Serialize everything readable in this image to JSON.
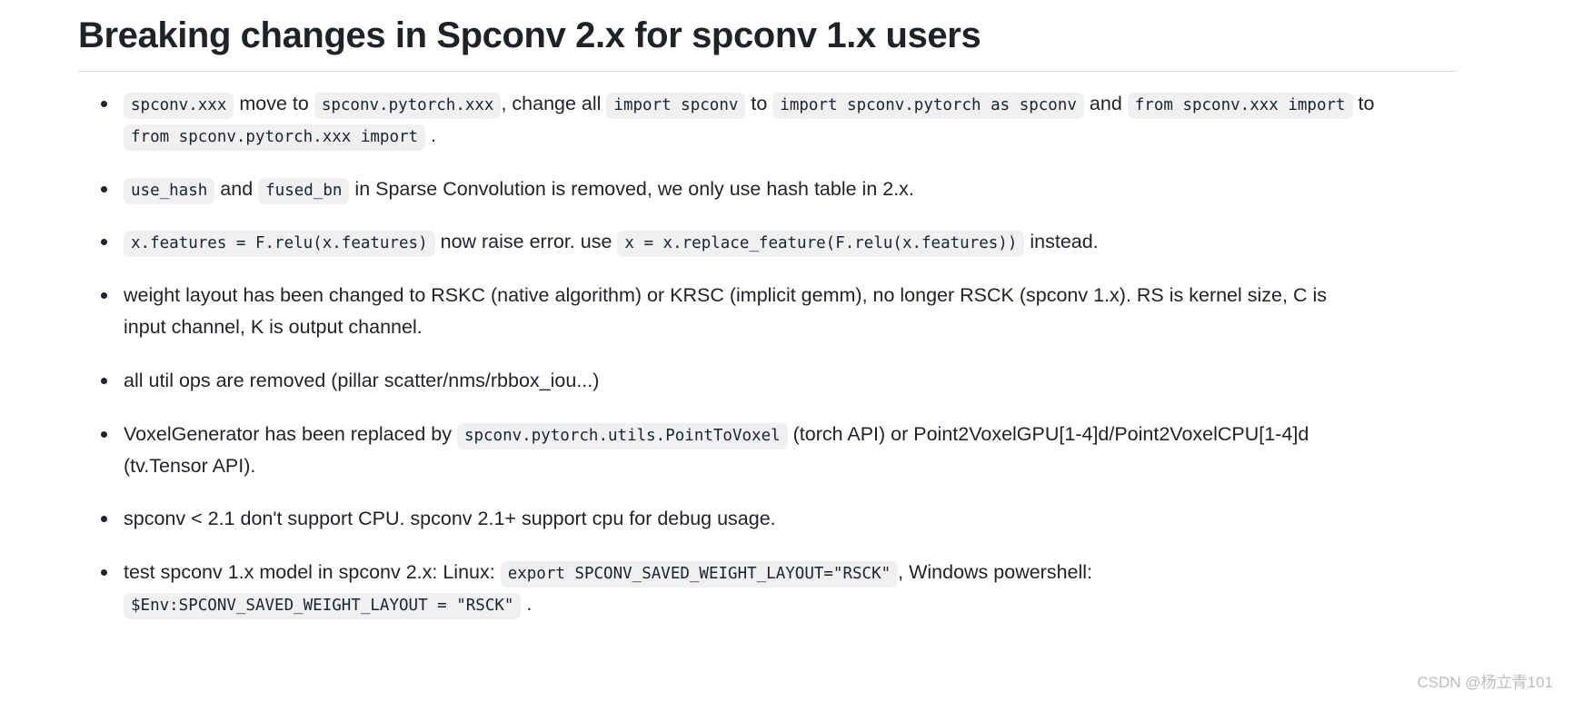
{
  "document": {
    "title": "Breaking changes in Spconv 2.x for spconv 1.x users",
    "bullets": {
      "b1": {
        "c1": "spconv.xxx",
        "t1": "move to",
        "c2": "spconv.pytorch.xxx",
        "t2": ", change all",
        "c3": "import spconv",
        "t3": "to",
        "c4": "import spconv.pytorch as spconv",
        "t4": "and",
        "c5": "from spconv.xxx import",
        "t5": "to",
        "c6": "from spconv.pytorch.xxx import",
        "t6": "."
      },
      "b2": {
        "c1": "use_hash",
        "t1": "and",
        "c2": "fused_bn",
        "t2": "in Sparse Convolution is removed, we only use hash table in 2.x."
      },
      "b3": {
        "c1": "x.features = F.relu(x.features)",
        "t1": "now raise error. use",
        "c2": "x = x.replace_feature(F.relu(x.features))",
        "t2": "instead."
      },
      "b4": {
        "t1": "weight layout has been changed to RSKC (native algorithm) or KRSC (implicit gemm), no longer RSCK (spconv 1.x). RS is kernel size, C is input channel, K is output channel."
      },
      "b5": {
        "t1": "all util ops are removed (pillar scatter/nms/rbbox_iou...)"
      },
      "b6": {
        "t1": "VoxelGenerator has been replaced by",
        "c1": "spconv.pytorch.utils.PointToVoxel",
        "t2": "(torch API) or Point2VoxelGPU[1-4]d/Point2VoxelCPU[1-4]d (tv.Tensor API)."
      },
      "b7": {
        "t1": "spconv < 2.1 don't support CPU. spconv 2.1+ support cpu for debug usage."
      },
      "b8": {
        "t1": "test spconv 1.x model in spconv 2.x: Linux:",
        "c1": "export SPCONV_SAVED_WEIGHT_LAYOUT=\"RSCK\"",
        "t2": ", Windows powershell:",
        "c2": "$Env:SPCONV_SAVED_WEIGHT_LAYOUT = \"RSCK\"",
        "t3": "."
      }
    }
  },
  "watermark": {
    "text": "CSDN @杨立青101"
  },
  "colors": {
    "text": "#1f2328",
    "code_background": "#eef0f2",
    "rule": "#d8dee4",
    "watermark": "#b9bcc0",
    "page_background": "#ffffff"
  }
}
